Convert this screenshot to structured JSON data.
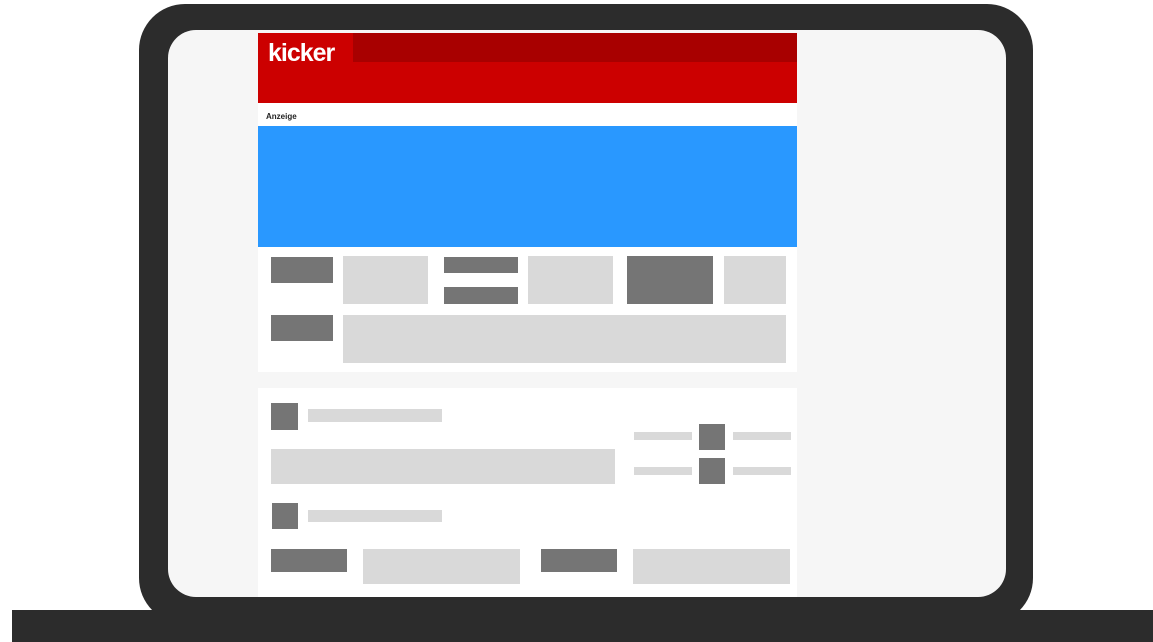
{
  "site": {
    "logo_text": "kicker",
    "ad_label": "Anzeige"
  },
  "colors": {
    "frame": "#2c2c2c",
    "screen": "#f6f6f6",
    "header_red": "#cc0000",
    "header_dark_red": "#a80000",
    "ad_blue": "#2998ff",
    "placeholder_dark": "#757575",
    "placeholder_light": "#d9d9d9"
  }
}
